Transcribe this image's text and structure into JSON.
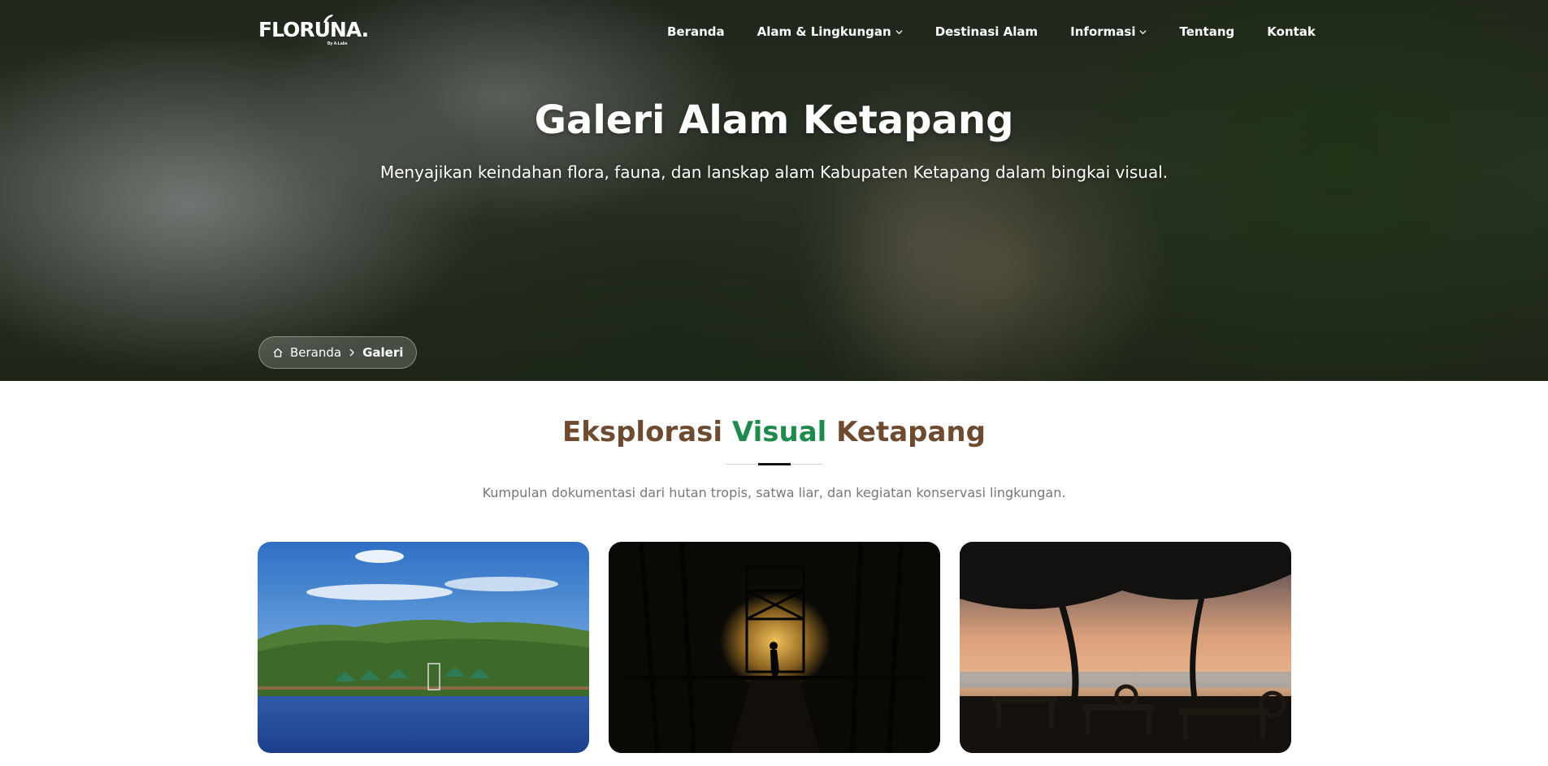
{
  "brand": {
    "logo": "FLORUNA.",
    "tagline": "By A-Labs"
  },
  "nav": {
    "items": [
      {
        "label": "Beranda",
        "dropdown": false
      },
      {
        "label": "Alam & Lingkungan",
        "dropdown": true
      },
      {
        "label": "Destinasi Alam",
        "dropdown": false
      },
      {
        "label": "Informasi",
        "dropdown": true
      },
      {
        "label": "Tentang",
        "dropdown": false
      },
      {
        "label": "Kontak",
        "dropdown": false
      }
    ]
  },
  "hero": {
    "title": "Galeri Alam Ketapang",
    "subtitle": "Menyajikan keindahan flora, fauna, dan lanskap alam Kabupaten Ketapang dalam bingkai visual."
  },
  "breadcrumb": {
    "home": "Beranda",
    "current": "Galeri"
  },
  "section": {
    "title_part1": "Eksplorasi",
    "title_accent": "Visual",
    "title_part2": "Ketapang",
    "subtitle": "Kumpulan dokumentasi dari hutan tropis, satwa liar, dan kegiatan konservasi lingkungan."
  },
  "colors": {
    "brown": "#6e4a30",
    "green": "#1e8a4c"
  },
  "icons": [
    "chevron-down-icon",
    "home-icon",
    "chevron-right-icon",
    "bird-icon"
  ]
}
